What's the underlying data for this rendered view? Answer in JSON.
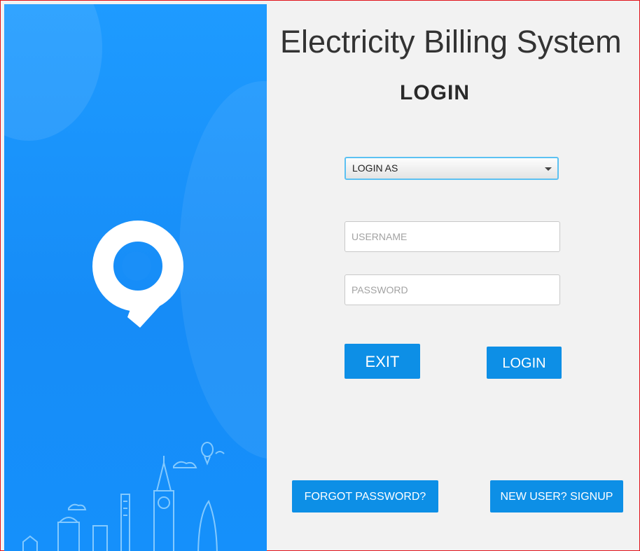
{
  "header": {
    "title": "Electricity Billing System",
    "heading": "LOGIN"
  },
  "form": {
    "role_select": {
      "value": "LOGIN AS"
    },
    "username": {
      "placeholder": "USERNAME",
      "value": ""
    },
    "password": {
      "placeholder": "PASSWORD",
      "value": ""
    }
  },
  "buttons": {
    "exit": "EXIT",
    "login": "LOGIN",
    "forgot": "FORGOT PASSWORD?",
    "signup": "NEW USER? SIGNUP"
  },
  "colors": {
    "panel_blue": "#1590fb",
    "button_blue": "#0d8fe6",
    "frame_red": "#e0141b"
  },
  "icons": [
    "location-pin-logo-icon",
    "city-skyline-illustration"
  ]
}
